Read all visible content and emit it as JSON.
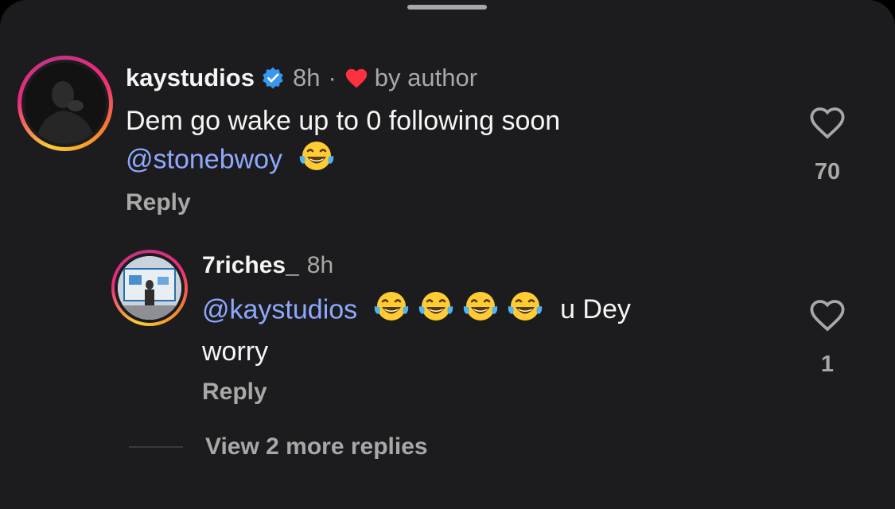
{
  "colors": {
    "sheet_bg": "#1c1c1e",
    "mention": "#8fa8ff",
    "verified": "#3897f0",
    "heart_red": "#ff3040",
    "muted": "#a8a8a8"
  },
  "comment": {
    "username": "kaystudios",
    "verified": true,
    "time": "8h",
    "separator": "·",
    "liked_by_author_label": "by author",
    "text": "Dem go wake up to 0 following soon",
    "mention": "@stonebwoy",
    "emoji_count": 1,
    "reply_label": "Reply",
    "likes": "70",
    "like_icon": "heart-outline-icon"
  },
  "reply": {
    "username": "7riches_",
    "time": "8h",
    "mention": "@kaystudios",
    "emoji_count": 4,
    "text_after_emojis": "u Dey",
    "text_line2": "worry",
    "reply_label": "Reply",
    "likes": "1",
    "like_icon": "heart-outline-icon"
  },
  "view_more_label": "View 2 more replies"
}
